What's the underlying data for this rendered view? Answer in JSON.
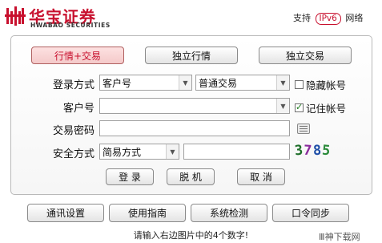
{
  "header": {
    "brand_cn": "华宝证券",
    "brand_en": "HWABAO SECURITIES",
    "support_prefix": "支持",
    "support_badge": "IPv6",
    "support_suffix": "网络"
  },
  "mode_tabs": [
    {
      "label": "行情+交易",
      "selected": true
    },
    {
      "label": "独立行情",
      "selected": false
    },
    {
      "label": "独立交易",
      "selected": false
    }
  ],
  "form": {
    "login_method_label": "登录方式",
    "login_method_value": "客户号",
    "trade_type_value": "普通交易",
    "hide_account_label": "隐藏帐号",
    "hide_account_checked": false,
    "account_label": "客户号",
    "account_value": "",
    "remember_account_label": "记住帐号",
    "remember_account_checked": true,
    "password_label": "交易密码",
    "password_value": "",
    "security_label": "安全方式",
    "security_method_value": "简易方式",
    "captcha_input_value": "",
    "captcha_digits": [
      {
        "char": "3",
        "color": "#1f6f2a"
      },
      {
        "char": "7",
        "color": "#8a2b9c"
      },
      {
        "char": "8",
        "color": "#1f4fa8"
      },
      {
        "char": "5",
        "color": "#2a8a3a"
      }
    ]
  },
  "actions": {
    "login": "登 录",
    "offline": "脱 机",
    "cancel": "取 消"
  },
  "footer_buttons": [
    "通讯设置",
    "使用指南",
    "系统检测",
    "口令同步"
  ],
  "hint": "请输入右边图片中的4个数字!",
  "watermark": "Ⅲ神下载网"
}
